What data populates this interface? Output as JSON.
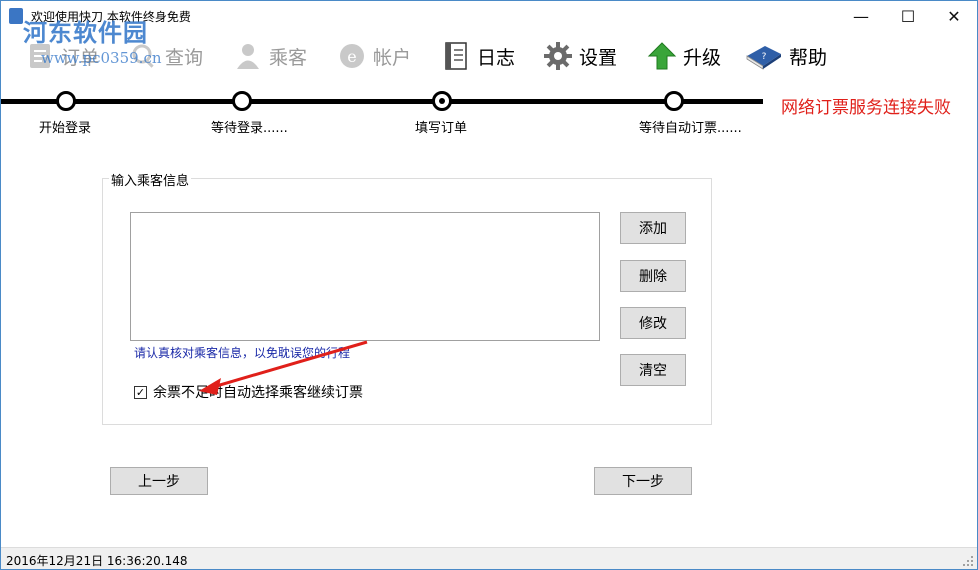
{
  "window": {
    "title": "欢迎使用快刀 本软件终身免费",
    "minimize_glyph": "—",
    "maximize_glyph": "☐",
    "close_glyph": "✕"
  },
  "watermark": {
    "name": "河东软件园",
    "url": "www.pc0359.cn"
  },
  "toolbar": {
    "items": [
      {
        "label": "订单",
        "icon": "order-icon",
        "enabled": false
      },
      {
        "label": "查询",
        "icon": "query-icon",
        "enabled": false
      },
      {
        "label": "乘客",
        "icon": "passenger-icon",
        "enabled": false
      },
      {
        "label": "帐户",
        "icon": "account-icon",
        "enabled": false
      },
      {
        "label": "日志",
        "icon": "log-icon",
        "enabled": true
      },
      {
        "label": "设置",
        "icon": "gear-icon",
        "enabled": true
      },
      {
        "label": "升级",
        "icon": "upgrade-icon",
        "enabled": true
      },
      {
        "label": "帮助",
        "icon": "help-book-icon",
        "enabled": true
      }
    ]
  },
  "steps": {
    "items": [
      {
        "label": "开始登录"
      },
      {
        "label": "等待登录......"
      },
      {
        "label": "填写订单",
        "current": true
      },
      {
        "label": "等待自动订票......"
      }
    ],
    "error_message": "网络订票服务连接失败"
  },
  "passenger_group": {
    "title": "输入乘客信息",
    "list_items": [],
    "buttons": {
      "add": "添加",
      "delete": "删除",
      "edit": "修改",
      "clear": "清空"
    },
    "hint": "请认真核对乘客信息，以免耽误您的行程",
    "auto_select": {
      "label": "余票不足时自动选择乘客继续订票",
      "checked": true
    }
  },
  "navigation": {
    "prev": "上一步",
    "next": "下一步"
  },
  "status_bar": {
    "datetime": "2016年12月21日 16:36:20.148"
  },
  "colors": {
    "error": "#e0201a",
    "hint": "#1b2aa8",
    "window_border": "#4a8ac7",
    "annotation_arrow": "#e0201a"
  }
}
